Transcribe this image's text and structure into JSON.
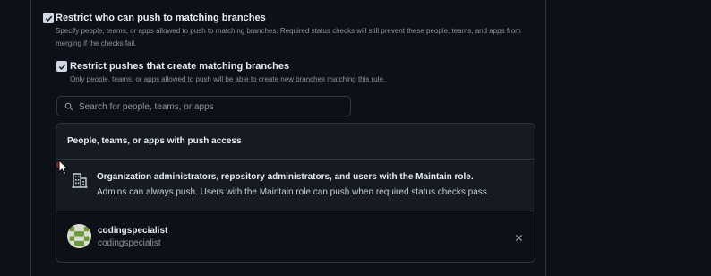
{
  "restrict_push": {
    "checked": true,
    "title": "Restrict who can push to matching branches",
    "description": "Specify people, teams, or apps allowed to push to matching branches. Required status checks will still prevent these people, teams, and apps from merging if the checks fail."
  },
  "restrict_create": {
    "checked": true,
    "title": "Restrict pushes that create matching branches",
    "description": "Only people, teams, or apps allowed to push will be able to create new branches matching this rule."
  },
  "search": {
    "placeholder": "Search for people, teams, or apps",
    "value": ""
  },
  "push_access": {
    "header": "People, teams, or apps with push access",
    "org_row": {
      "icon": "organization-icon",
      "title": "Organization administrators, repository administrators, and users with the Maintain role.",
      "subtitle": "Admins can always push. Users with the Maintain role can push when required status checks pass."
    },
    "users": [
      {
        "name": "codingspecialist",
        "login": "codingspecialist",
        "avatar": "identicon-avatar",
        "remove_icon": "close-icon"
      }
    ]
  },
  "colors": {
    "background": "#0d1117",
    "panel": "#161b22",
    "border": "#30363d",
    "text_primary": "#e6edf3",
    "text_muted": "#8b949e"
  }
}
